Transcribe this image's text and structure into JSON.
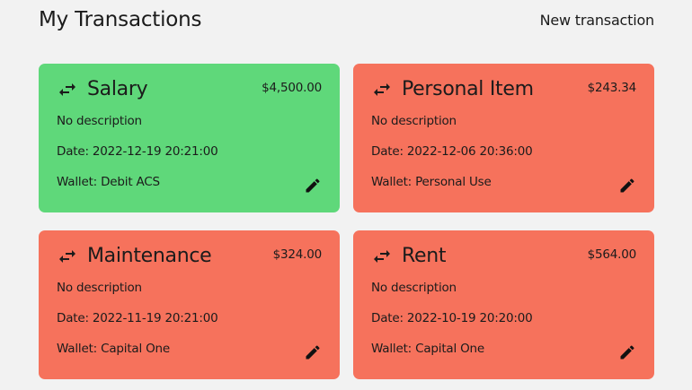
{
  "header": {
    "title": "My Transactions",
    "new_transaction_label": "New transaction"
  },
  "colors": {
    "income": "#5fd87a",
    "expense": "#f6725c",
    "background": "#f2f2f2"
  },
  "transactions": [
    {
      "title": "Salary",
      "amount": "$4,500.00",
      "description": "No description",
      "date": "Date: 2022-12-19 20:21:00",
      "wallet": "Wallet: Debit ACS",
      "type": "income"
    },
    {
      "title": "Personal Item",
      "amount": "$243.34",
      "description": "No description",
      "date": "Date: 2022-12-06 20:36:00",
      "wallet": "Wallet: Personal Use",
      "type": "expense"
    },
    {
      "title": "Maintenance",
      "amount": "$324.00",
      "description": "No description",
      "date": "Date: 2022-11-19 20:21:00",
      "wallet": "Wallet: Capital One",
      "type": "expense"
    },
    {
      "title": "Rent",
      "amount": "$564.00",
      "description": "No description",
      "date": "Date: 2022-10-19 20:20:00",
      "wallet": "Wallet: Capital One",
      "type": "expense"
    }
  ],
  "icons": {
    "transaction": "swap-horizontal-icon",
    "edit": "pencil-icon"
  }
}
